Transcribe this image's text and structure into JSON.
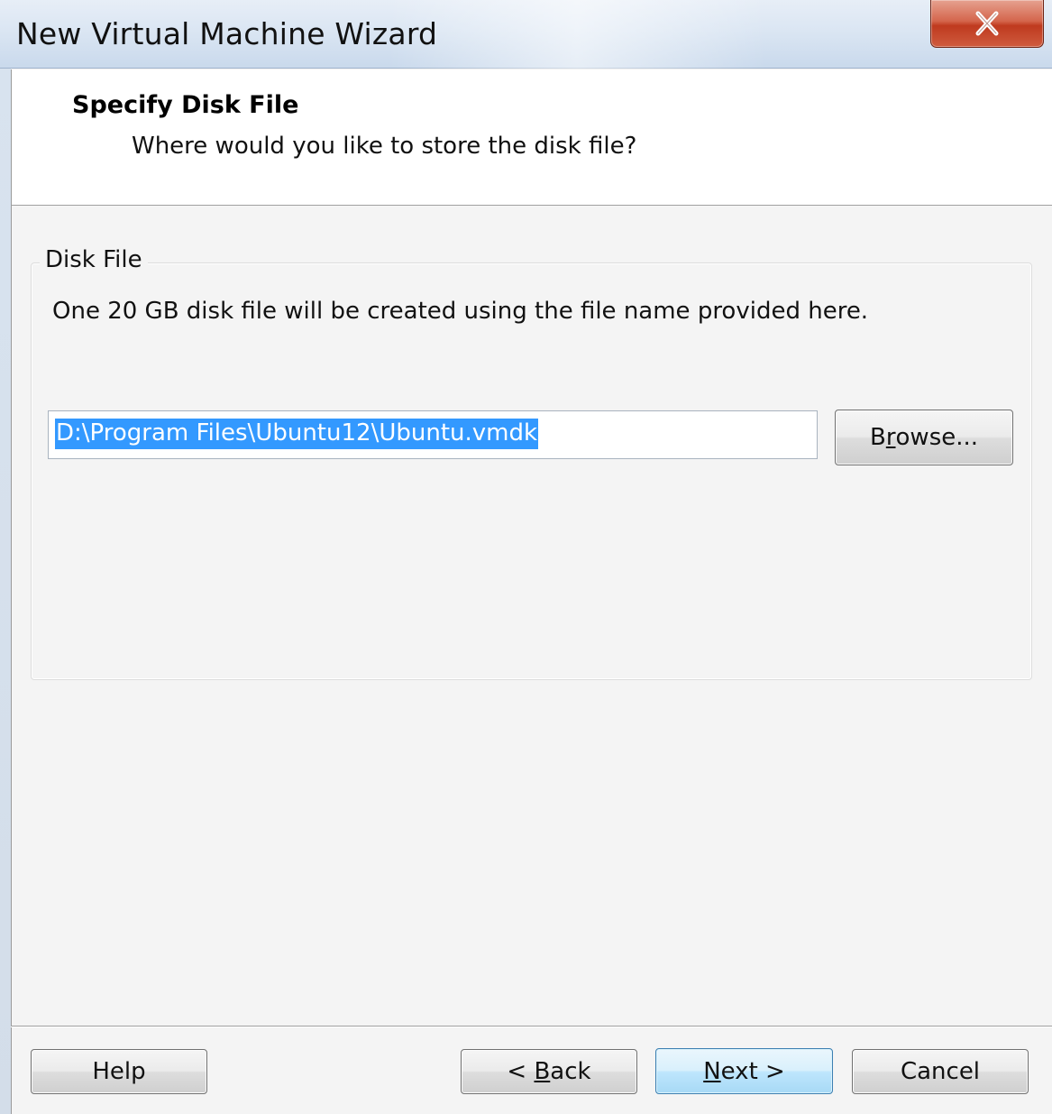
{
  "window": {
    "title": "New Virtual Machine Wizard",
    "close_icon": "close-icon"
  },
  "header": {
    "title": "Specify Disk File",
    "subtitle": "Where would you like to store the disk file?"
  },
  "disk_file_group": {
    "legend": "Disk File",
    "description": "One 20 GB disk file will be created using the file name provided here.",
    "path_value": "D:\\Program Files\\Ubuntu12\\Ubuntu.vmdk",
    "browse_label_pre": "B",
    "browse_label_mnemonic": "r",
    "browse_label_post": "owse..."
  },
  "footer": {
    "help_label": "Help",
    "back_label_pre": "< ",
    "back_label_mnemonic": "B",
    "back_label_post": "ack",
    "next_label_mnemonic": "N",
    "next_label_post": "ext >",
    "cancel_label": "Cancel"
  },
  "colors": {
    "selection": "#3399ff",
    "close_button": "#c9472b"
  }
}
